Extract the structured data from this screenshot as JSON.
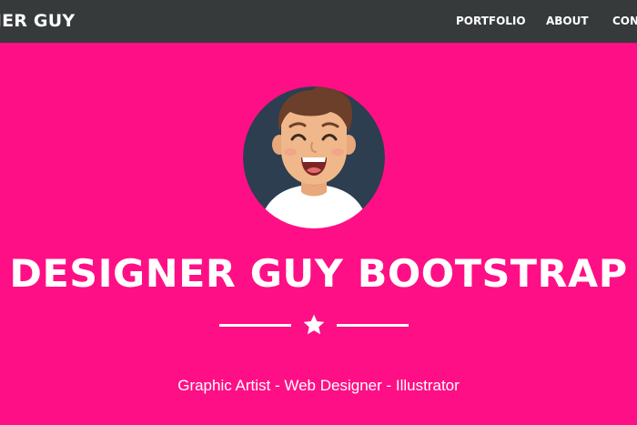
{
  "navbar": {
    "brand": "NER GUY",
    "links": [
      "PORTFOLIO",
      "ABOUT",
      "CON"
    ]
  },
  "masthead": {
    "avatar_icon": "smiling-man-avatar-icon",
    "heading": "DESIGNER GUY BOOTSTRAP",
    "divider_icon": "star-icon",
    "subheading": "Graphic Artist - Web Designer - Illustrator"
  },
  "colors": {
    "background": "#ff0f85",
    "navbar": "#363a3b",
    "text": "#ffffff",
    "avatar_circle": "#2c3e50"
  }
}
